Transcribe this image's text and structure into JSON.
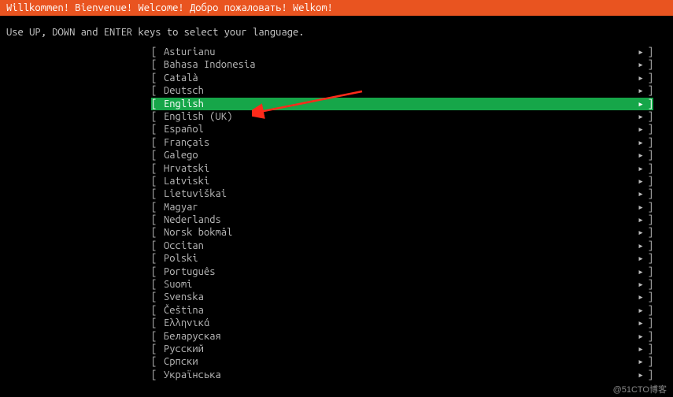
{
  "header": {
    "title": "Willkommen! Bienvenue! Welcome! Добро пожаловать! Welkom!"
  },
  "instruction": "Use UP, DOWN and ENTER keys to select your language.",
  "brackets": {
    "left": "[ ",
    "right": "]",
    "arrow": "▸"
  },
  "languages": [
    "Asturianu",
    "Bahasa Indonesia",
    "Català",
    "Deutsch",
    "English",
    "English (UK)",
    "Español",
    "Français",
    "Galego",
    "Hrvatski",
    "Latviski",
    "Lietuviškai",
    "Magyar",
    "Nederlands",
    "Norsk bokmål",
    "Occitan",
    "Polski",
    "Português",
    "Suomi",
    "Svenska",
    "Čeština",
    "Ελληνικά",
    "Беларуская",
    "Русский",
    "Српски",
    "Українська"
  ],
  "selected_index": 4,
  "watermark": "@51CTO博客"
}
